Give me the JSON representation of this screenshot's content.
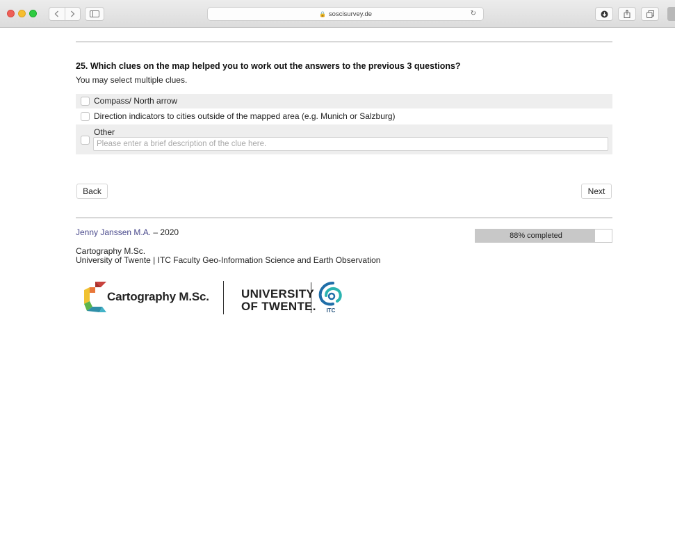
{
  "browser": {
    "url": "soscisurvey.de",
    "back_icon": "chevron-left-icon",
    "forward_icon": "chevron-right-icon"
  },
  "question": {
    "title": "25. Which clues on the map helped you to work out the answers to the previous 3 questions?",
    "hint": "You may select multiple clues.",
    "options": [
      {
        "label": "Compass/ North arrow",
        "checked": false
      },
      {
        "label": "Direction indicators to cities outside of the mapped area (e.g. Munich or Salzburg)",
        "checked": false
      },
      {
        "label": "Other",
        "checked": false
      }
    ],
    "other_placeholder": "Please enter a brief description of the clue here.",
    "other_value": ""
  },
  "nav": {
    "back_label": "Back",
    "next_label": "Next"
  },
  "footer": {
    "author_name": "Jenny Janssen M.A.",
    "author_suffix": " – 2020",
    "program": "Cartography M.Sc.",
    "institution": "University of Twente | ITC Faculty Geo-Information Science and Earth Observation",
    "progress_text": "88% completed",
    "progress_value": 0.88
  },
  "logos": {
    "cartography_text": "Cartography M.Sc.",
    "ut_line1": "UNIVERSITY",
    "ut_line2": "OF TWENTE.",
    "itc_text": "ITC"
  },
  "colors": {
    "author_link": "#4a4a8c",
    "cart_red": "#c8423e",
    "cart_yellow": "#f0c232",
    "cart_green": "#5db44a",
    "cart_teal": "#2f8fa8",
    "itc_blue": "#1f6ea8",
    "itc_teal": "#2ab3b0"
  }
}
